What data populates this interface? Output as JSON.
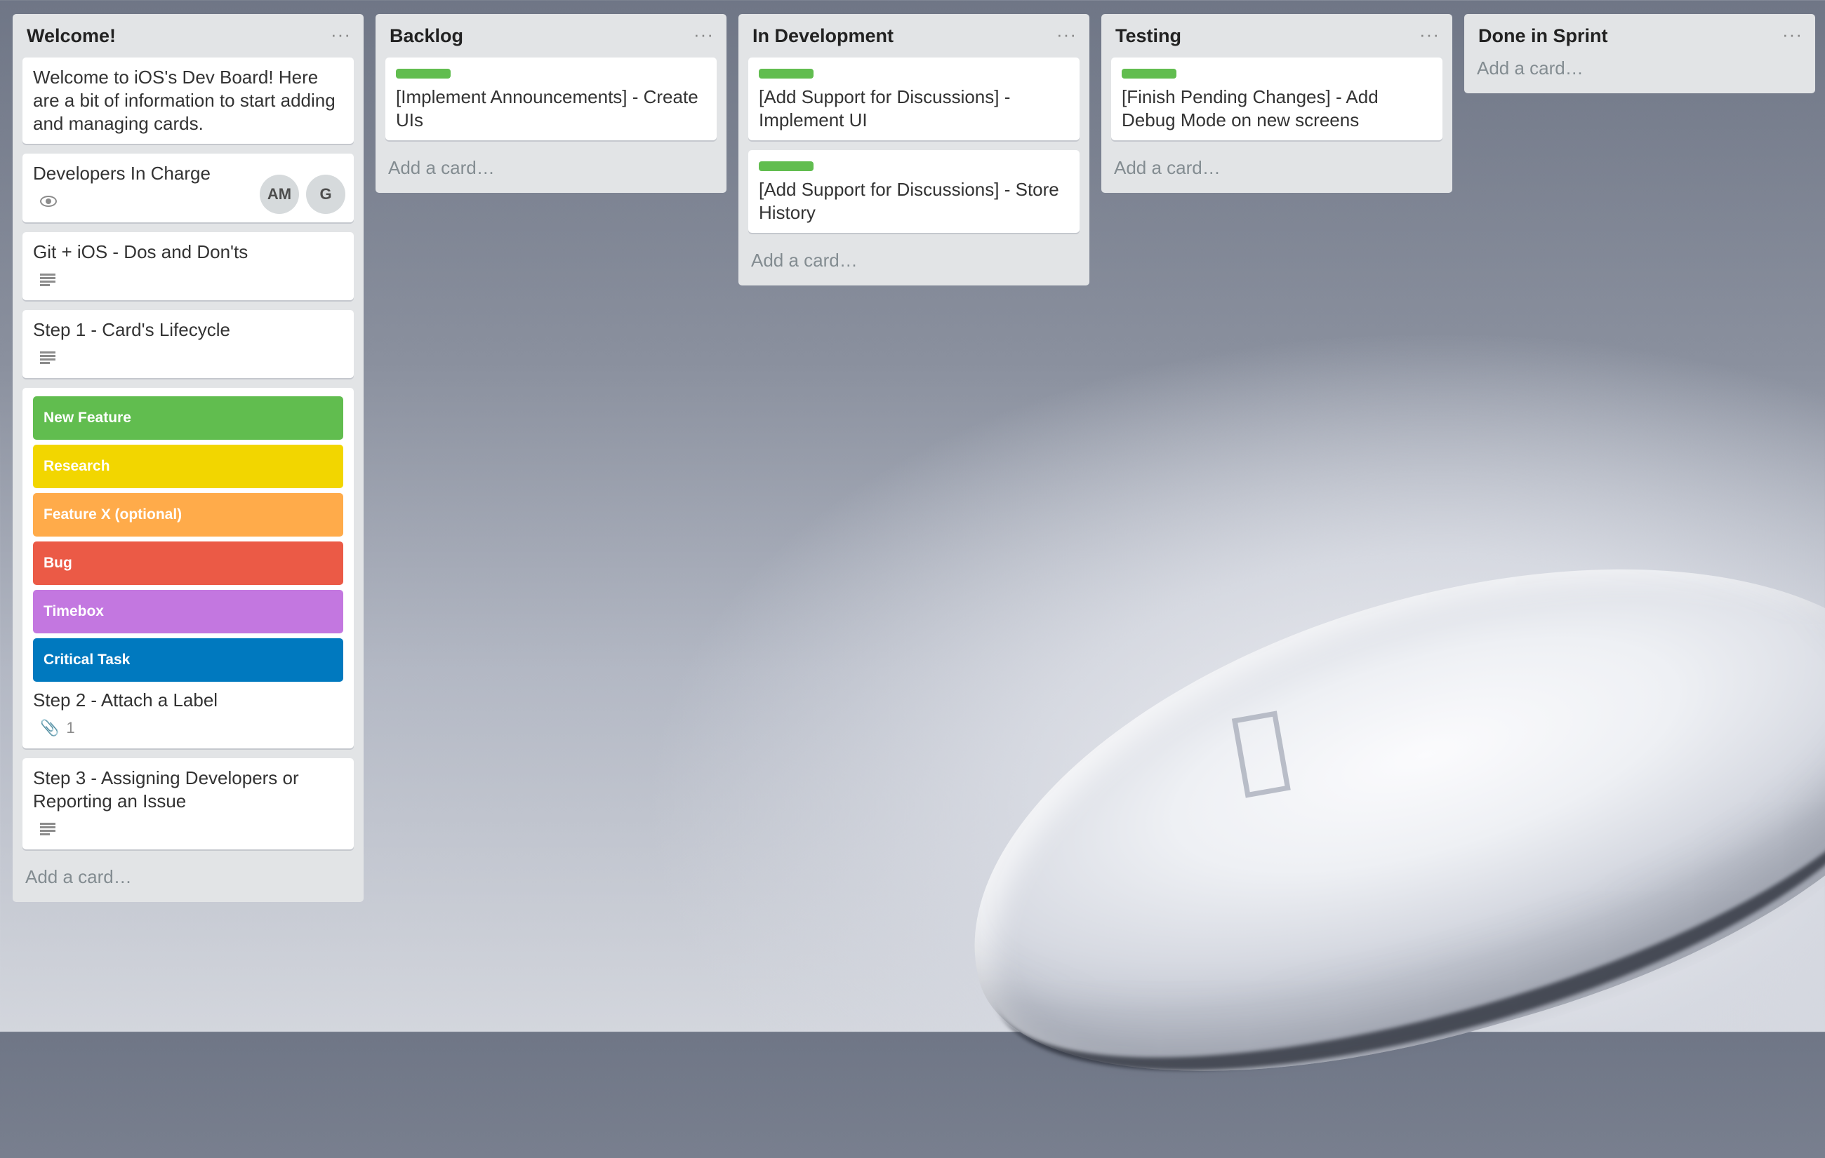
{
  "lists": [
    {
      "title": "Welcome!",
      "menu": "···",
      "add_card": "Add a card…",
      "cards": {
        "intro": "Welcome to iOS's Dev Board! Here are a bit of information to start adding and managing cards.",
        "developers": {
          "title": "Developers In Charge",
          "members": [
            "AM",
            "G"
          ]
        },
        "git": "Git + iOS - Dos and Don'ts",
        "step1": "Step 1 - Card's Lifecycle",
        "step2": {
          "labels": [
            {
              "name": "New Feature",
              "color": "#61bd4f"
            },
            {
              "name": "Research",
              "color": "#f2d600"
            },
            {
              "name": "Feature X (optional)",
              "color": "#ffab4a"
            },
            {
              "name": "Bug",
              "color": "#eb5a46"
            },
            {
              "name": "Timebox",
              "color": "#c377e0"
            },
            {
              "name": "Critical Task",
              "color": "#0079bf"
            }
          ],
          "title": "Step 2 - Attach a Label",
          "attachments": "1"
        },
        "step3": "Step 3 - Assigning Developers or Reporting an Issue"
      }
    },
    {
      "title": "Backlog",
      "menu": "···",
      "add_card": "Add a card…",
      "cards": [
        {
          "text": "[Implement Announcements] - Create UIs",
          "label_color": "#61bd4f"
        }
      ]
    },
    {
      "title": "In Development",
      "menu": "···",
      "add_card": "Add a card…",
      "cards": [
        {
          "text": "[Add Support for Discussions] - Implement UI",
          "label_color": "#61bd4f"
        },
        {
          "text": "[Add Support for Discussions] - Store History",
          "label_color": "#61bd4f"
        }
      ]
    },
    {
      "title": "Testing",
      "menu": "···",
      "add_card": "Add a card…",
      "cards": [
        {
          "text": "[Finish Pending Changes] - Add Debug Mode on new screens",
          "label_color": "#61bd4f"
        }
      ]
    },
    {
      "title": "Done in Sprint",
      "menu": "···",
      "add_card": "Add a card…",
      "cards": []
    }
  ],
  "icons": {
    "description": "description-icon",
    "watch": "eye-icon",
    "attachment": "paperclip-icon",
    "menu": "ellipsis-icon"
  }
}
